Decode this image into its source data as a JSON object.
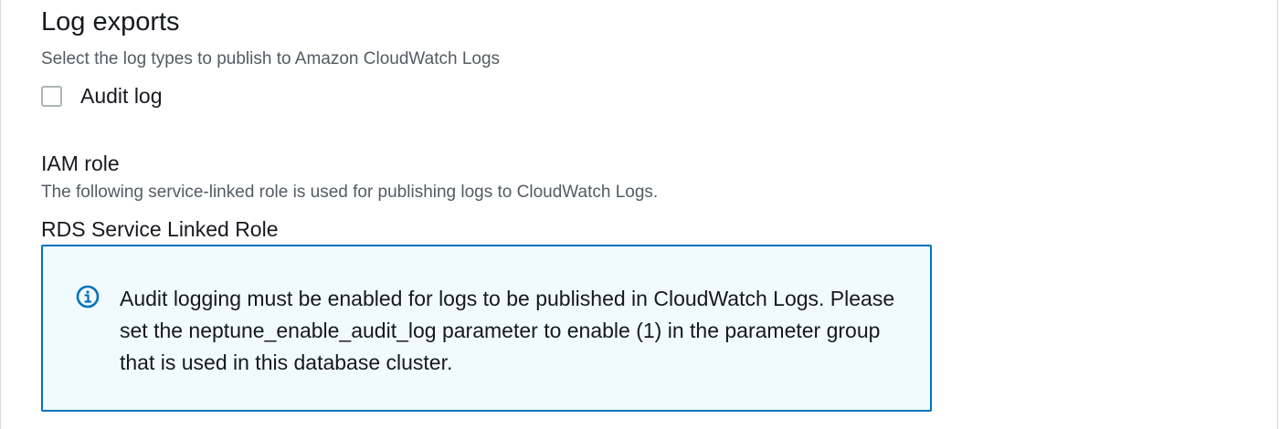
{
  "log_exports": {
    "title": "Log exports",
    "description": "Select the log types to publish to Amazon CloudWatch Logs",
    "options": [
      {
        "label": "Audit log",
        "checked": false
      }
    ]
  },
  "iam_role": {
    "label": "IAM role",
    "description": "The following service-linked role is used for publishing logs to CloudWatch Logs.",
    "value": "RDS Service Linked Role"
  },
  "info_alert": {
    "icon": "info-icon",
    "text": "Audit logging must be enabled for logs to be published in CloudWatch Logs. Please set the neptune_enable_audit_log parameter to enable (1) in the parameter group that is used in this database cluster.",
    "border_color": "#0073bb",
    "background_color": "#f1faff"
  }
}
